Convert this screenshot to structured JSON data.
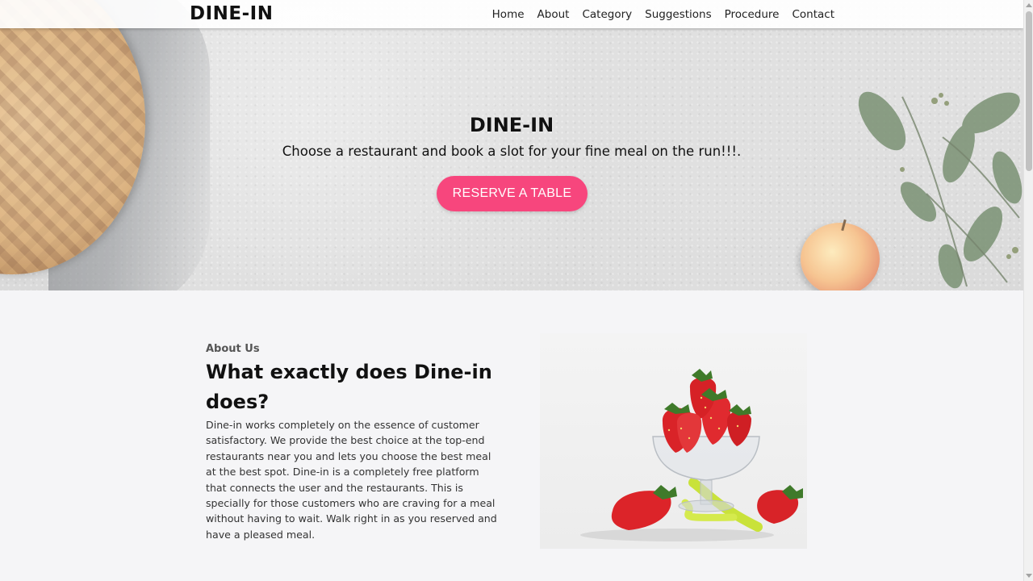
{
  "navbar": {
    "brand": "DINE-IN",
    "links": [
      "Home",
      "About",
      "Category",
      "Suggestions",
      "Procedure",
      "Contact"
    ]
  },
  "hero": {
    "title": "DINE-IN",
    "subtitle": "Choose a restaurant and book a slot for your fine meal on the run!!!.",
    "button_label": "RESERVE A TABLE",
    "button_color": "#f7467d"
  },
  "about": {
    "label": "About Us",
    "heading": "What exactly does Dine-in does?",
    "text": "Dine-in works completely on the essence of customer satisfactory. We provide the best choice at the top-end restaurants near you and lets you choose the best meal at the best spot. Dine-in is a completely free platform that connects the user and the restaurants. This is specially for those customers who are craving for a meal without having to wait. Walk right in as you reserved and have a pleased meal."
  }
}
